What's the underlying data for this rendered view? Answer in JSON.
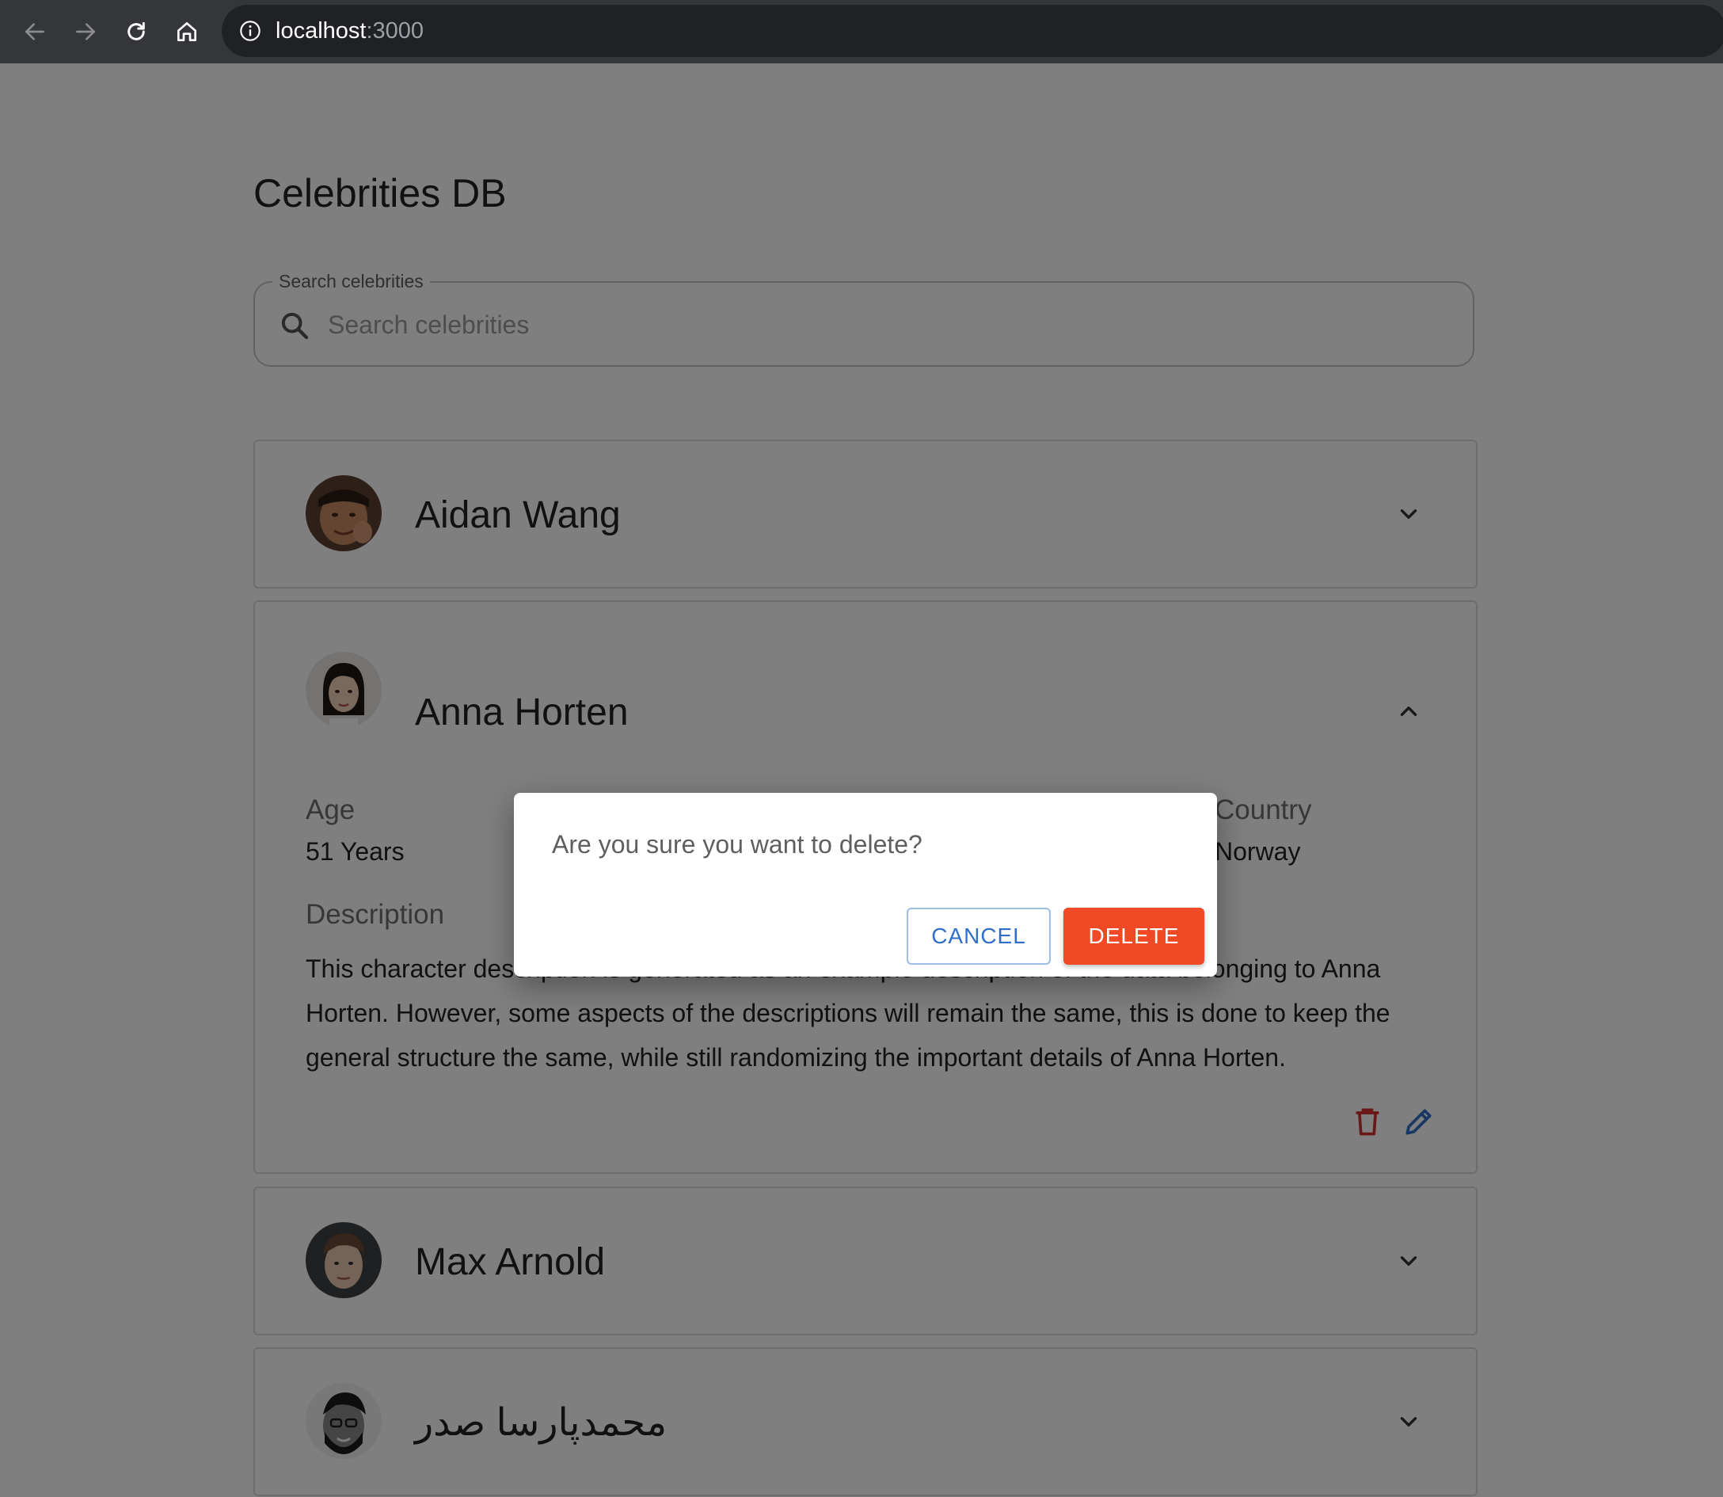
{
  "browser": {
    "url_host": "localhost",
    "url_port": ":3000"
  },
  "page": {
    "title": "Celebrities DB"
  },
  "search": {
    "label": "Search celebrities",
    "placeholder": "Search celebrities",
    "value": ""
  },
  "celebrities": [
    {
      "name": "Aidan Wang",
      "expanded": false
    },
    {
      "name": "Anna Horten",
      "expanded": true,
      "age_label": "Age",
      "age_value": "51 Years",
      "country_label": "Country",
      "country_value": "Norway",
      "description_label": "Description",
      "description": "This character description is generated as an example description of the data belonging to Anna Horten. However, some aspects of the descriptions will remain the same, this is done to keep the general structure the same, while still randomizing the important details of Anna Horten."
    },
    {
      "name": "Max Arnold",
      "expanded": false
    },
    {
      "name": "محمدپارسا صدر",
      "expanded": false
    }
  ],
  "dialog": {
    "message": "Are you sure you want to delete?",
    "cancel_label": "CANCEL",
    "delete_label": "DELETE"
  },
  "colors": {
    "delete_accent": "#ef4a25",
    "primary_blue": "#2f6fc9",
    "trash_icon": "#d32f2f"
  }
}
